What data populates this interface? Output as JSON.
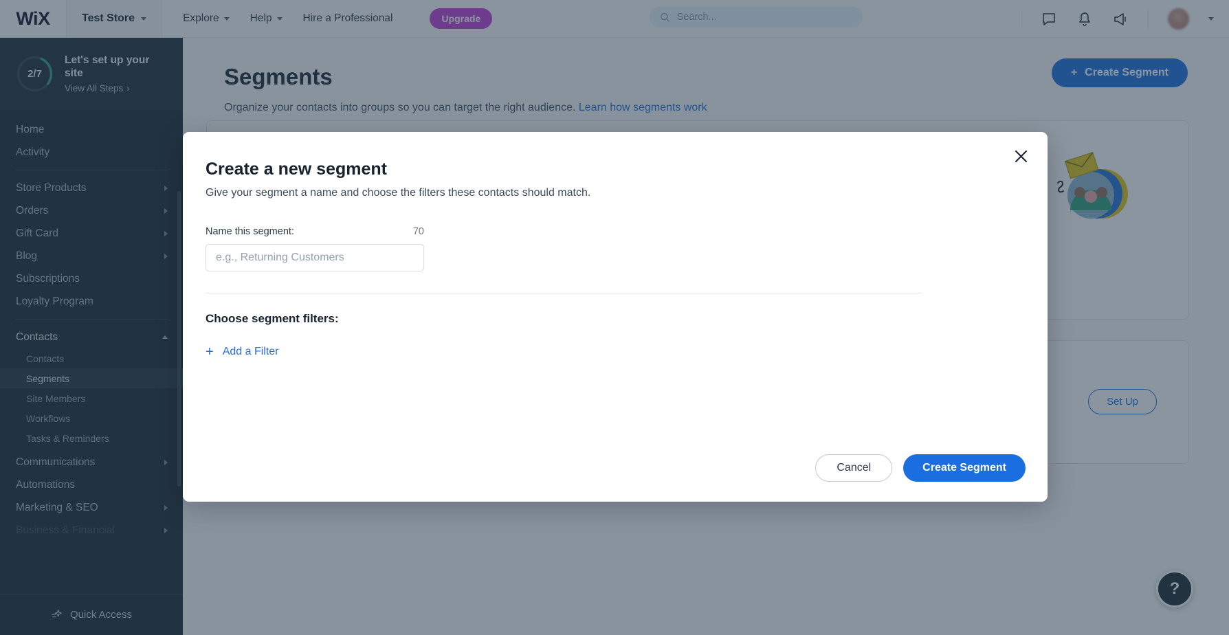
{
  "topbar": {
    "logo": "WiX",
    "site_name": "Test Store",
    "nav": [
      {
        "label": "Explore",
        "has_chevron": true
      },
      {
        "label": "Help",
        "has_chevron": true
      },
      {
        "label": "Hire a Professional",
        "has_chevron": false
      }
    ],
    "upgrade_label": "Upgrade",
    "search_placeholder": "Search...",
    "search_value": "",
    "icons": [
      "chat-icon",
      "bell-icon",
      "megaphone-icon"
    ]
  },
  "sidebar": {
    "setup": {
      "progress_text": "2/7",
      "progress_done": 2,
      "progress_total": 7,
      "title": "Let's set up your site",
      "link": "View All Steps"
    },
    "items": [
      {
        "label": "Home",
        "type": "item"
      },
      {
        "label": "Activity",
        "type": "item"
      },
      {
        "label": "divider",
        "type": "divider"
      },
      {
        "label": "Store Products",
        "type": "item",
        "expandable": true
      },
      {
        "label": "Orders",
        "type": "item",
        "expandable": true
      },
      {
        "label": "Gift Card",
        "type": "item",
        "expandable": true
      },
      {
        "label": "Blog",
        "type": "item",
        "expandable": true
      },
      {
        "label": "Subscriptions",
        "type": "item"
      },
      {
        "label": "Loyalty Program",
        "type": "item"
      },
      {
        "label": "divider",
        "type": "divider"
      },
      {
        "label": "Contacts",
        "type": "item",
        "expandable": true,
        "expanded": true
      },
      {
        "label": "Contacts",
        "type": "sub"
      },
      {
        "label": "Segments",
        "type": "sub",
        "selected": true
      },
      {
        "label": "Site Members",
        "type": "sub"
      },
      {
        "label": "Workflows",
        "type": "sub"
      },
      {
        "label": "Tasks & Reminders",
        "type": "sub"
      },
      {
        "label": "Communications",
        "type": "item",
        "expandable": true
      },
      {
        "label": "Automations",
        "type": "item"
      },
      {
        "label": "Marketing & SEO",
        "type": "item",
        "expandable": true
      },
      {
        "label": "Business & Financial",
        "type": "item",
        "expandable": true,
        "cutoff": true
      }
    ],
    "quick_access": "Quick Access"
  },
  "page": {
    "title": "Segments",
    "subtitle": "Organize your contacts into groups so you can target the right audience.",
    "subtitle_link": "Learn how segments work",
    "create_button": "Create Segment",
    "setup_button": "Set Up",
    "help_button": "?"
  },
  "modal": {
    "title": "Create a new segment",
    "subtitle": "Give your segment a name and choose the filters these contacts should match.",
    "name_label": "Name this segment:",
    "name_counter": "70",
    "name_value": "",
    "name_placeholder": "e.g., Returning Customers",
    "filters_title": "Choose segment filters:",
    "add_filter_label": "Add a Filter",
    "cancel_label": "Cancel",
    "submit_label": "Create Segment",
    "close_icon": "close-icon"
  },
  "colors": {
    "accent_blue": "#1a6ee0",
    "upgrade_purple": "#c13bd6",
    "sidebar_bg": "#17242f",
    "progress_ring": "#2f9e7e"
  }
}
